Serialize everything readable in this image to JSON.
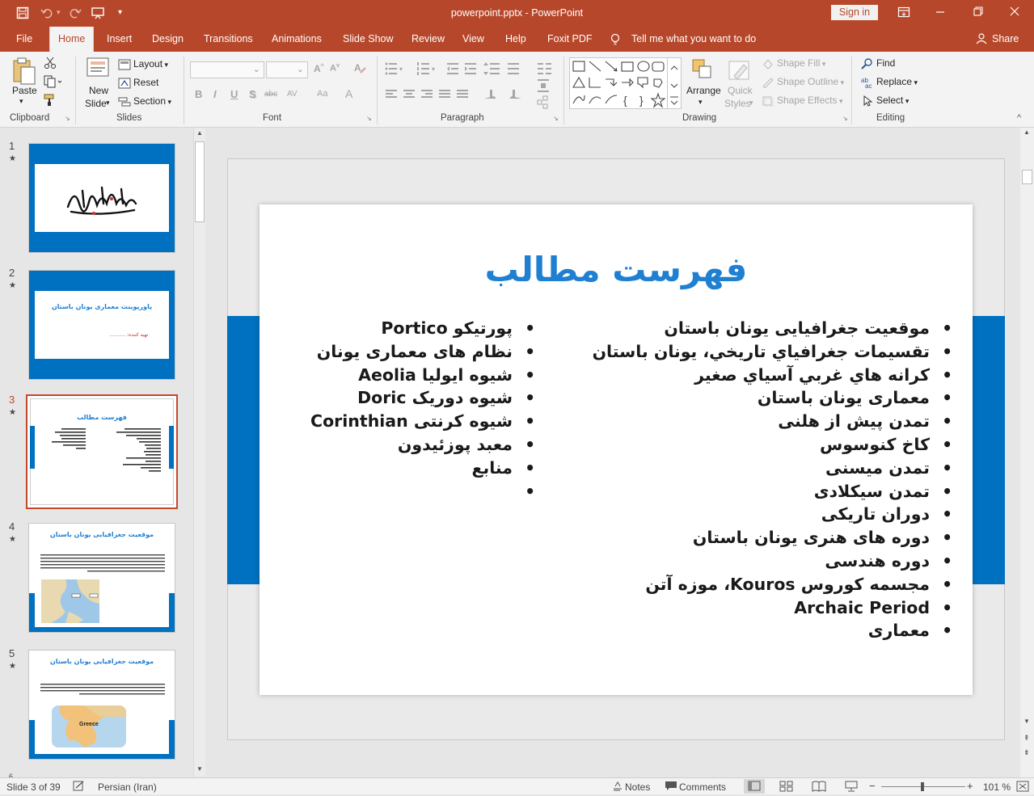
{
  "titlebar": {
    "doc_title": "powerpoint.pptx - PowerPoint",
    "signin_label": "Sign in"
  },
  "tabs": [
    {
      "label": "File"
    },
    {
      "label": "Home"
    },
    {
      "label": "Insert"
    },
    {
      "label": "Design"
    },
    {
      "label": "Transitions"
    },
    {
      "label": "Animations"
    },
    {
      "label": "Slide Show"
    },
    {
      "label": "Review"
    },
    {
      "label": "View"
    },
    {
      "label": "Help"
    },
    {
      "label": "Foxit PDF"
    }
  ],
  "tell_me": "Tell me what you want to do",
  "share_label": "Share",
  "ribbon": {
    "clipboard": {
      "paste": "Paste",
      "group": "Clipboard"
    },
    "slides": {
      "new_slide_1": "New",
      "new_slide_2": "Slide",
      "layout": "Layout",
      "reset": "Reset",
      "section": "Section",
      "group": "Slides"
    },
    "font": {
      "bold": "B",
      "italic": "I",
      "underline": "U",
      "shadow": "S",
      "strike": "abc",
      "spacing": "AV",
      "case": "Aa",
      "color": "A",
      "group": "Font"
    },
    "paragraph": {
      "group": "Paragraph"
    },
    "drawing": {
      "arrange": "Arrange",
      "quick_1": "Quick",
      "quick_2": "Styles",
      "shape_fill": "Shape Fill",
      "shape_outline": "Shape Outline",
      "shape_effects": "Shape Effects",
      "group": "Drawing"
    },
    "editing": {
      "find": "Find",
      "replace": "Replace",
      "select": "Select",
      "group": "Editing"
    }
  },
  "thumbnails": [
    {
      "num": "1",
      "title": ""
    },
    {
      "num": "2",
      "title": "پاورپوینت معماری یونان باستان",
      "subtitle": "تهیه کننده: .........."
    },
    {
      "num": "3",
      "title": "فهرست مطالب"
    },
    {
      "num": "4",
      "title": "موقعیت جغرافیایی یونان باستان"
    },
    {
      "num": "5",
      "title": "موقعیت جغرافیایی یونان باستان",
      "map_label": "Greece"
    }
  ],
  "slide": {
    "title": "فهرست مطالب",
    "right_list": [
      "موقعیت جغرافیایی یونان باستان",
      "تقسيمات جغرافياي تاريخي، يونان باستان",
      "كرانه هاي غربي آسياي صغير",
      "معماری یونان باستان",
      "تمدن پیش از هلنی",
      "کاخ کنوسوس",
      "تمدن میسنی",
      "تمدن سیکلادی",
      "دوران تاریکی",
      "دوره های هنری یونان باستان",
      "دوره هندسی",
      "مجسمه کوروس Kouros، موزه آتن",
      "Archaic Period",
      "معماری"
    ],
    "left_list": [
      "پورتیکو  Portico",
      "نظام های معماری یونان",
      "شیوه ایولیا  Aeolia",
      "شیوه دوریک Doric",
      "شیوه کرنتی Corinthian",
      "معبد پوزئیدون",
      "منابع",
      ""
    ]
  },
  "status": {
    "slide_info": "Slide 3 of 39",
    "language": "Persian (Iran)",
    "notes": "Notes",
    "comments": "Comments",
    "zoom": "101 %"
  },
  "colors": {
    "accent": "#b7472a",
    "slide_band": "#0070c0",
    "title_blue": "#1f7fd1"
  }
}
